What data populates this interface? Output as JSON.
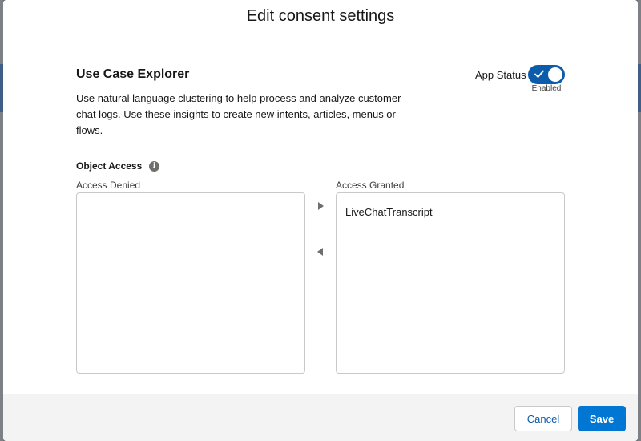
{
  "modal": {
    "title": "Edit consent settings"
  },
  "app": {
    "name": "Use Case Explorer",
    "description": "Use natural language clustering to help process and analyze customer chat logs. Use these insights to create new intents, articles, menus or flows.",
    "status_label": "App Status",
    "status_enabled": true,
    "status_text": "Enabled"
  },
  "object_access": {
    "label": "Object Access",
    "info_glyph": "i",
    "denied_label": "Access Denied",
    "granted_label": "Access Granted",
    "denied_items": [],
    "granted_items": [
      "LiveChatTranscript"
    ]
  },
  "icons": {
    "info": "info-icon",
    "move_right": "triangle-right-icon",
    "move_left": "triangle-left-icon",
    "toggle_check": "check-icon"
  },
  "colors": {
    "brand": "#0176d3",
    "toggle_on": "#0b5cab",
    "link": "#0b5cab"
  },
  "footer": {
    "cancel_label": "Cancel",
    "save_label": "Save"
  }
}
